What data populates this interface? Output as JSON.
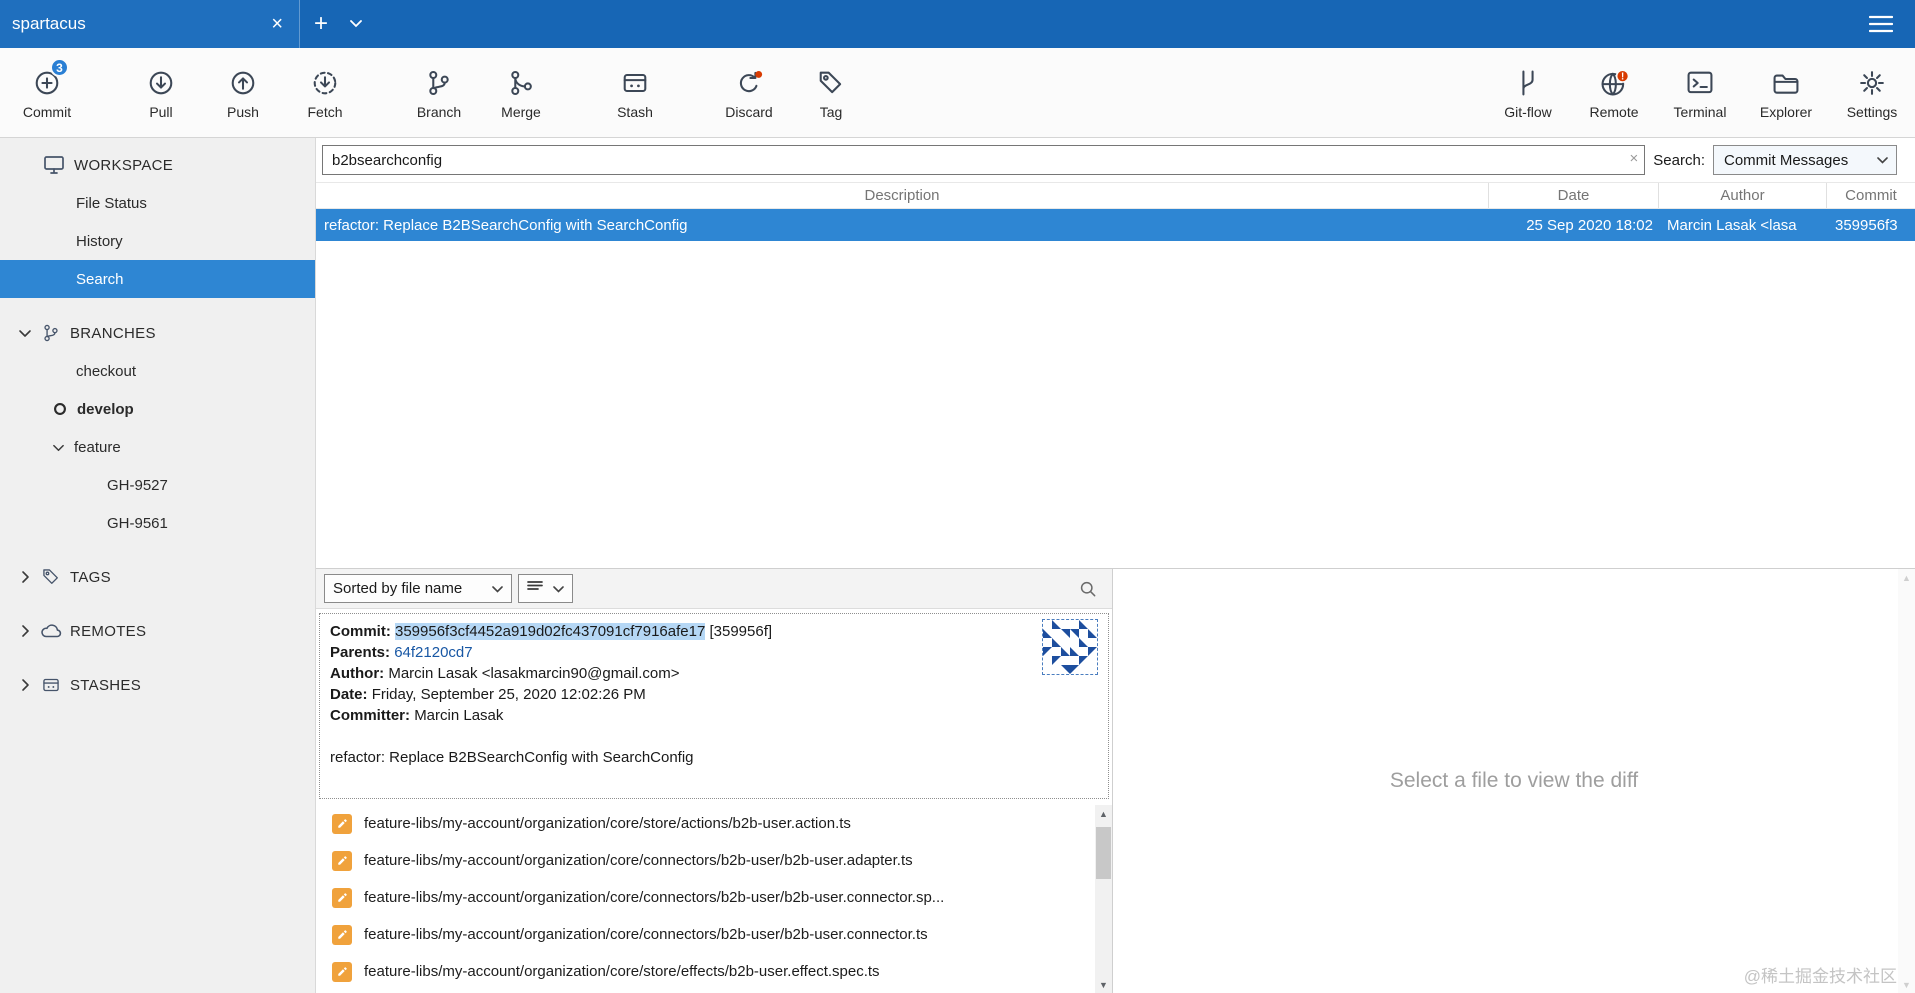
{
  "window": {
    "tab_title": "spartacus",
    "close_tab": "×",
    "new_tab": "+"
  },
  "toolbar": {
    "commit": "Commit",
    "commit_badge": "3",
    "pull": "Pull",
    "push": "Push",
    "fetch": "Fetch",
    "branch": "Branch",
    "merge": "Merge",
    "stash": "Stash",
    "discard": "Discard",
    "tag": "Tag",
    "gitflow": "Git-flow",
    "remote": "Remote",
    "remote_badge": "!",
    "terminal": "Terminal",
    "explorer": "Explorer",
    "settings": "Settings"
  },
  "sidebar": {
    "workspace": {
      "label": "WORKSPACE",
      "file_status": "File Status",
      "history": "History",
      "search": "Search"
    },
    "branches": {
      "label": "BRANCHES",
      "checkout": "checkout",
      "develop": "develop",
      "feature": "feature",
      "gh9527": "GH-9527",
      "gh9561": "GH-9561"
    },
    "tags": {
      "label": "TAGS"
    },
    "remotes": {
      "label": "REMOTES"
    },
    "stashes": {
      "label": "STASHES"
    }
  },
  "search": {
    "query": "b2bsearchconfig",
    "clear": "×",
    "label": "Search:",
    "mode": "Commit Messages"
  },
  "commits": {
    "headers": {
      "description": "Description",
      "date": "Date",
      "author": "Author",
      "commit": "Commit"
    },
    "rows": [
      {
        "description": "refactor: Replace B2BSearchConfig with SearchConfig",
        "date": "25 Sep 2020 18:02",
        "author": "Marcin Lasak <lasa",
        "commit": "359956f3"
      }
    ]
  },
  "detail": {
    "sort": "Sorted by file name",
    "commit_label": "Commit:",
    "hash": "359956f3cf4452a919d02fc437091cf7916afe17",
    "short": "[359956f]",
    "parents_label": "Parents:",
    "parent": "64f2120cd7",
    "author_label": "Author:",
    "author": "Marcin Lasak <lasakmarcin90@gmail.com>",
    "date_label": "Date:",
    "date": "Friday, September 25, 2020 12:02:26 PM",
    "committer_label": "Committer:",
    "committer": "Marcin Lasak",
    "message": "refactor: Replace B2BSearchConfig with SearchConfig"
  },
  "files": [
    {
      "path": "feature-libs/my-account/organization/core/store/actions/b2b-user.action.ts",
      "status": "modified"
    },
    {
      "path": "feature-libs/my-account/organization/core/connectors/b2b-user/b2b-user.adapter.ts",
      "status": "modified"
    },
    {
      "path": "feature-libs/my-account/organization/core/connectors/b2b-user/b2b-user.connector.sp...",
      "status": "modified"
    },
    {
      "path": "feature-libs/my-account/organization/core/connectors/b2b-user/b2b-user.connector.ts",
      "status": "modified"
    },
    {
      "path": "feature-libs/my-account/organization/core/store/effects/b2b-user.effect.spec.ts",
      "status": "modified"
    }
  ],
  "diff": {
    "placeholder": "Select a file to view the diff"
  },
  "watermark": "@稀土掘金技术社区",
  "colors": {
    "titlebar": "#1766b5",
    "selection": "#2e86d3",
    "modified_icon": "#f0a23c",
    "error_badge": "#d83b01",
    "link": "#1857a4",
    "hash_highlight": "#b5d7f5"
  }
}
